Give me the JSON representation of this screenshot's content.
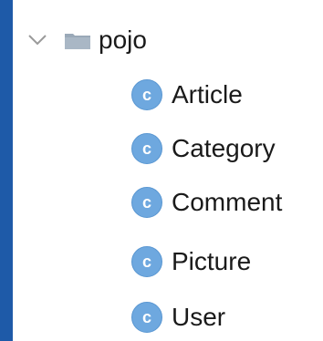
{
  "colors": {
    "background": "#1e5aa8",
    "panel": "#ffffff",
    "class_icon": "#6ea8df",
    "text": "#1a1a1a"
  },
  "tree": {
    "package": {
      "expand_icon": "chevron-down-icon",
      "icon": "folder-icon",
      "label": "pojo"
    },
    "classes": [
      {
        "icon": "class-icon",
        "icon_letter": "c",
        "label": "Article"
      },
      {
        "icon": "class-icon",
        "icon_letter": "c",
        "label": "Category"
      },
      {
        "icon": "class-icon",
        "icon_letter": "c",
        "label": "Comment"
      },
      {
        "icon": "class-icon",
        "icon_letter": "c",
        "label": "Picture"
      },
      {
        "icon": "class-icon",
        "icon_letter": "c",
        "label": "User"
      }
    ]
  }
}
